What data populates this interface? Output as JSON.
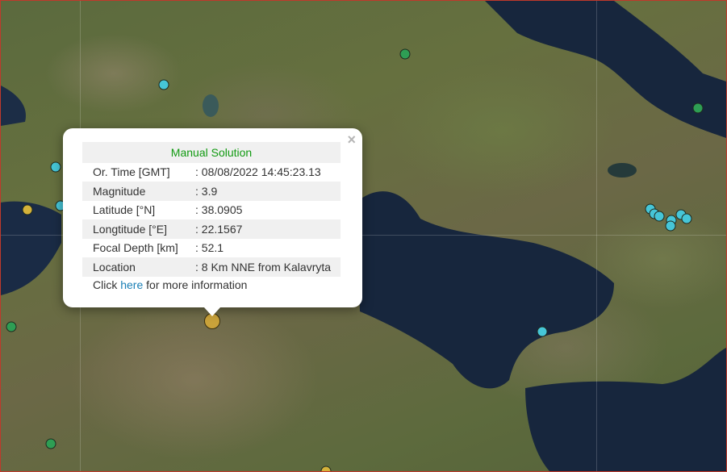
{
  "map": {
    "layer": "satellite",
    "marker_colors": {
      "green": "#2e9e54",
      "cyan": "#46c6d8",
      "gold": "#d4b23a",
      "selected": "#c9a23a"
    }
  },
  "popup": {
    "heading": "Manual Solution",
    "close_symbol": "×",
    "rows": [
      {
        "label": "Or. Time [GMT]",
        "value": ": 08/08/2022 14:45:23.13"
      },
      {
        "label": "Magnitude",
        "value": ": 3.9"
      },
      {
        "label": "Latitude [°N]",
        "value": ": 38.0905"
      },
      {
        "label": "Longtitude [°E]",
        "value": ": 22.1567"
      },
      {
        "label": "Focal Depth [km]",
        "value": ": 52.1"
      },
      {
        "label": "Location",
        "value": ": 8 Km NNE from Kalavryta"
      }
    ],
    "more_prefix": "Click ",
    "more_link": "here",
    "more_suffix": " for more information"
  }
}
